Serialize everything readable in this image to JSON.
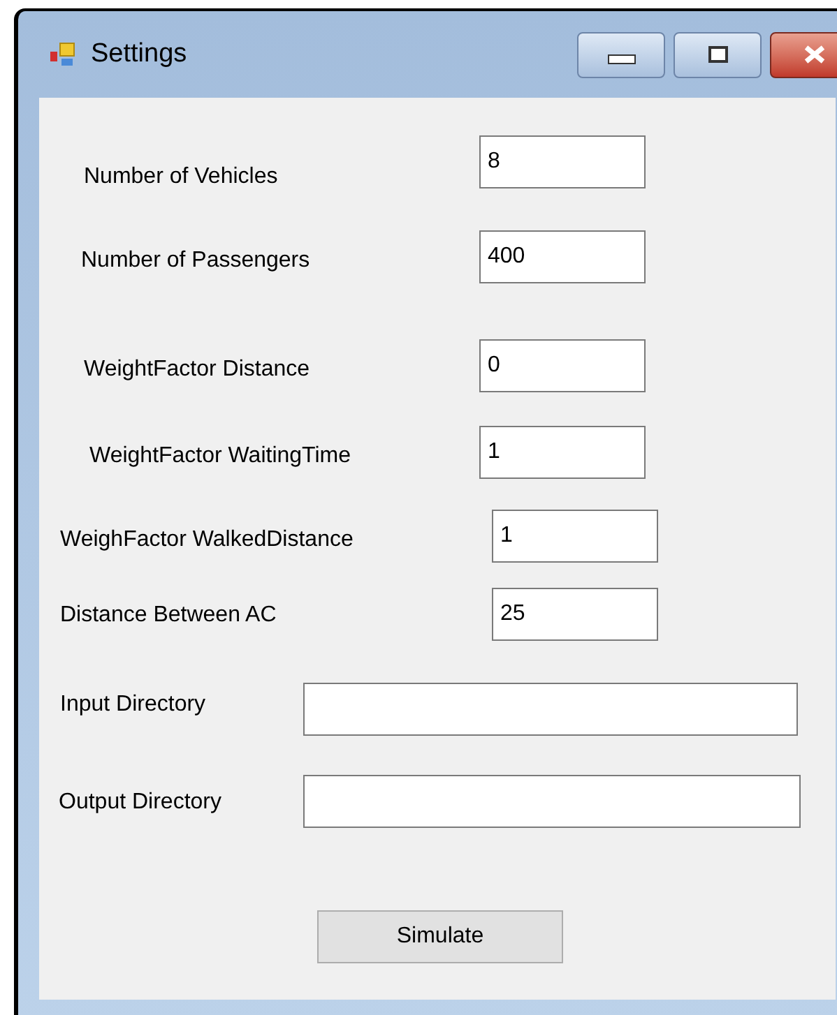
{
  "window": {
    "title": "Settings"
  },
  "fields": [
    {
      "label": "Number of Vehicles",
      "value": "8"
    },
    {
      "label": "Number of Passengers",
      "value": "400"
    },
    {
      "label": "WeightFactor Distance",
      "value": "0"
    },
    {
      "label": "WeightFactor WaitingTime",
      "value": "1"
    },
    {
      "label": "WeighFactor WalkedDistance",
      "value": "1"
    },
    {
      "label": "Distance Between AC",
      "value": "25"
    },
    {
      "label": "Input Directory"
    },
    {
      "label": "Output Directory"
    }
  ],
  "button": "Simulate"
}
